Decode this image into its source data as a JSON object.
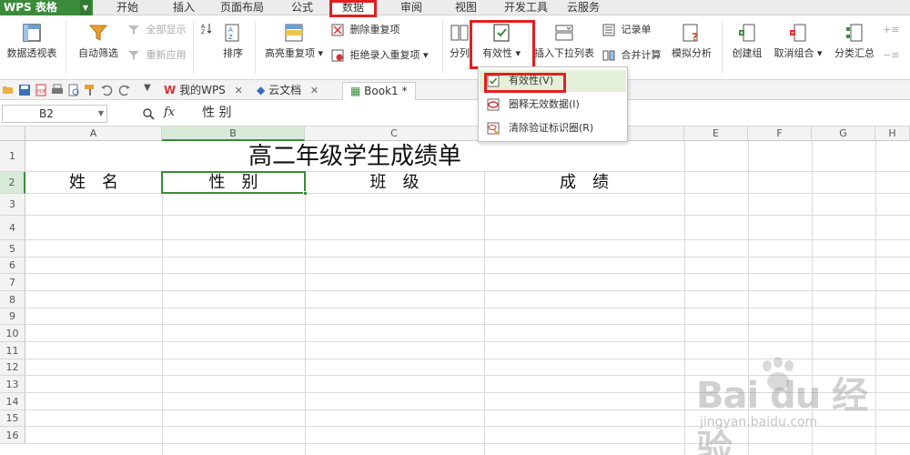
{
  "app": {
    "name": "WPS 表格"
  },
  "menu": {
    "tabs": [
      "开始",
      "插入",
      "页面布局",
      "公式",
      "数据",
      "审阅",
      "视图",
      "开发工具",
      "云服务"
    ],
    "active": "数据"
  },
  "ribbon": {
    "pivot": "数据透视表",
    "autofilter": "自动筛选",
    "show_all": "全部显示",
    "reapply": "重新应用",
    "sort": "排序",
    "highlight_dup": "高亮重复项",
    "remove_dup": "删除重复项",
    "reject_dup": "拒绝录入重复项",
    "split": "分列",
    "validity": "有效性",
    "insert_dropdown": "插入下拉列表",
    "record_form": "记录单",
    "consolidate": "合并计算",
    "what_if": "模拟分析",
    "group": "创建组",
    "ungroup": "取消组合",
    "subtotal": "分类汇总"
  },
  "tabstrip": {
    "my_wps": "我的WPS",
    "cloud_doc": "云文档",
    "book": "Book1 *"
  },
  "formula": {
    "cell_ref": "B2",
    "fx": "fx",
    "content": "性  别"
  },
  "grid": {
    "columns": [
      "A",
      "B",
      "C",
      "D",
      "E",
      "F",
      "G",
      "H"
    ],
    "rows": [
      "1",
      "2",
      "3",
      "4",
      "5",
      "6",
      "7",
      "8",
      "9",
      "10",
      "11",
      "12",
      "13",
      "14",
      "15",
      "16"
    ],
    "title": "高二年级学生成绩单",
    "headers": [
      "姓　名",
      "性　别",
      "班　级",
      "成　绩"
    ]
  },
  "dropdown": {
    "items": [
      "有效性(V)",
      "圈释无效数据(I)",
      "清除验证标识圈(R)"
    ]
  },
  "watermark": {
    "brand": "Bai du 经验",
    "url": "jingyan.baidu.com"
  },
  "colors": {
    "accent": "#3a8b3a",
    "highlight_box": "#e02020"
  }
}
